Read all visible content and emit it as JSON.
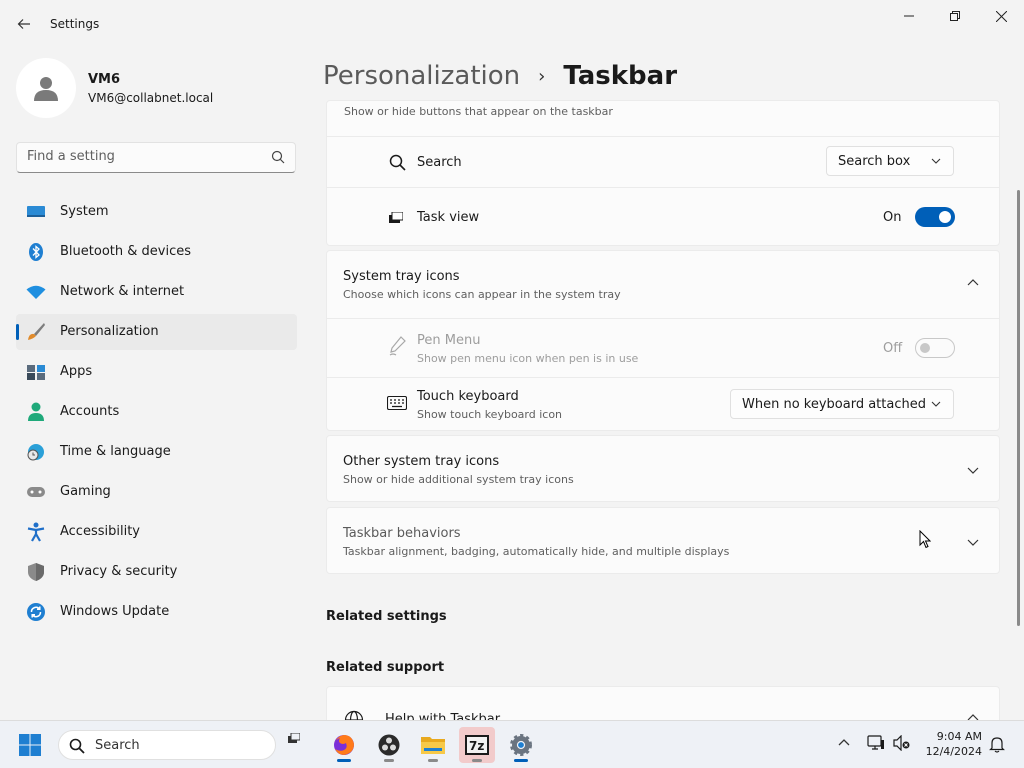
{
  "window": {
    "title": "Settings"
  },
  "profile": {
    "name": "VM6",
    "email": "VM6@collabnet.local"
  },
  "search": {
    "placeholder": "Find a setting"
  },
  "sidebar": {
    "items": [
      {
        "label": "System",
        "icon": "system-icon"
      },
      {
        "label": "Bluetooth & devices",
        "icon": "bluetooth-icon"
      },
      {
        "label": "Network & internet",
        "icon": "wifi-icon"
      },
      {
        "label": "Personalization",
        "icon": "brush-icon",
        "active": true
      },
      {
        "label": "Apps",
        "icon": "apps-icon"
      },
      {
        "label": "Accounts",
        "icon": "person-icon"
      },
      {
        "label": "Time & language",
        "icon": "clock-globe-icon"
      },
      {
        "label": "Gaming",
        "icon": "gamepad-icon"
      },
      {
        "label": "Accessibility",
        "icon": "accessibility-icon"
      },
      {
        "label": "Privacy & security",
        "icon": "shield-icon"
      },
      {
        "label": "Windows Update",
        "icon": "update-icon"
      }
    ]
  },
  "breadcrumb": {
    "parent": "Personalization",
    "separator": "›",
    "current": "Taskbar"
  },
  "taskbar_items": {
    "subtitle": "Show or hide buttons that appear on the taskbar",
    "search": {
      "label": "Search",
      "value": "Search box"
    },
    "task_view": {
      "label": "Task view",
      "state": "On"
    }
  },
  "system_tray": {
    "title": "System tray icons",
    "subtitle": "Choose which icons can appear in the system tray",
    "pen_menu": {
      "label": "Pen Menu",
      "subtitle": "Show pen menu icon when pen is in use",
      "state": "Off"
    },
    "touch_keyboard": {
      "label": "Touch keyboard",
      "subtitle": "Show touch keyboard icon",
      "value": "When no keyboard attached"
    }
  },
  "other_tray": {
    "title": "Other system tray icons",
    "subtitle": "Show or hide additional system tray icons"
  },
  "behaviors": {
    "title": "Taskbar behaviors",
    "subtitle": "Taskbar alignment, badging, automatically hide, and multiple displays"
  },
  "related": {
    "settings": "Related settings",
    "support": "Related support",
    "help": "Help with Taskbar"
  },
  "os_taskbar": {
    "search": "Search",
    "time": "9:04 AM",
    "date": "12/4/2024"
  },
  "colors": {
    "accent": "#005fb8"
  }
}
